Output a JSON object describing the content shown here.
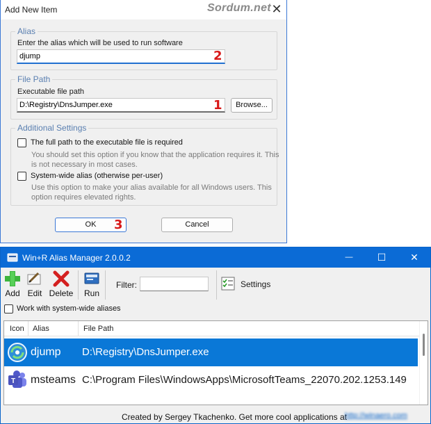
{
  "dialog": {
    "title": "Add New Item",
    "watermark": "Sordum.net",
    "close_glyph": "✕",
    "alias_group": {
      "legend": "Alias",
      "label": "Enter the alias which will be used to run software",
      "value": "djump",
      "marker": "2"
    },
    "filepath_group": {
      "legend": "File Path",
      "label": "Executable file path",
      "value": "D:\\Registry\\DnsJumper.exe",
      "marker": "1",
      "browse_label": "Browse..."
    },
    "additional_group": {
      "legend": "Additional Settings",
      "option_fullpath": {
        "label": "The full path to the executable file is required",
        "checked": false,
        "hint": "You should set this option if you know that the application requires it. This is not necessary in most cases."
      },
      "option_systemwide": {
        "label": "System-wide alias (otherwise per-user)",
        "checked": false,
        "hint": "Use this option to make your alias available for all Windows users. This option requires elevated rights."
      }
    },
    "ok_label": "OK",
    "ok_marker": "3",
    "cancel_label": "Cancel"
  },
  "window": {
    "title": "Win+R Alias Manager 2.0.0.2",
    "minimize_glyph": "—",
    "maximize_glyph": "☐",
    "close_glyph": "✕",
    "toolbar": {
      "add_label": "Add",
      "edit_label": "Edit",
      "delete_label": "Delete",
      "run_label": "Run",
      "filter_label": "Filter:",
      "filter_value": "",
      "settings_label": "Settings"
    },
    "systemwide_label": "Work with system-wide aliases",
    "systemwide_checked": false,
    "list": {
      "columns": [
        "Icon",
        "Alias",
        "File Path"
      ],
      "rows": [
        {
          "icon": "dns-jumper-icon",
          "alias": "djump",
          "path": "D:\\Registry\\DnsJumper.exe",
          "selected": true
        },
        {
          "icon": "teams-icon",
          "alias": "msteams",
          "path": "C:\\Program Files\\WindowsApps\\MicrosoftTeams_22070.202.1253.149",
          "selected": false
        }
      ]
    },
    "footer_text": "Created by Sergey Tkachenko. Get more cool applications at",
    "footer_link": "http://winaero.com"
  },
  "colors": {
    "accent": "#0b6bd6",
    "selection": "#0a78d7",
    "marker_red": "#d81818",
    "legend_blue": "#5a7fb0"
  }
}
